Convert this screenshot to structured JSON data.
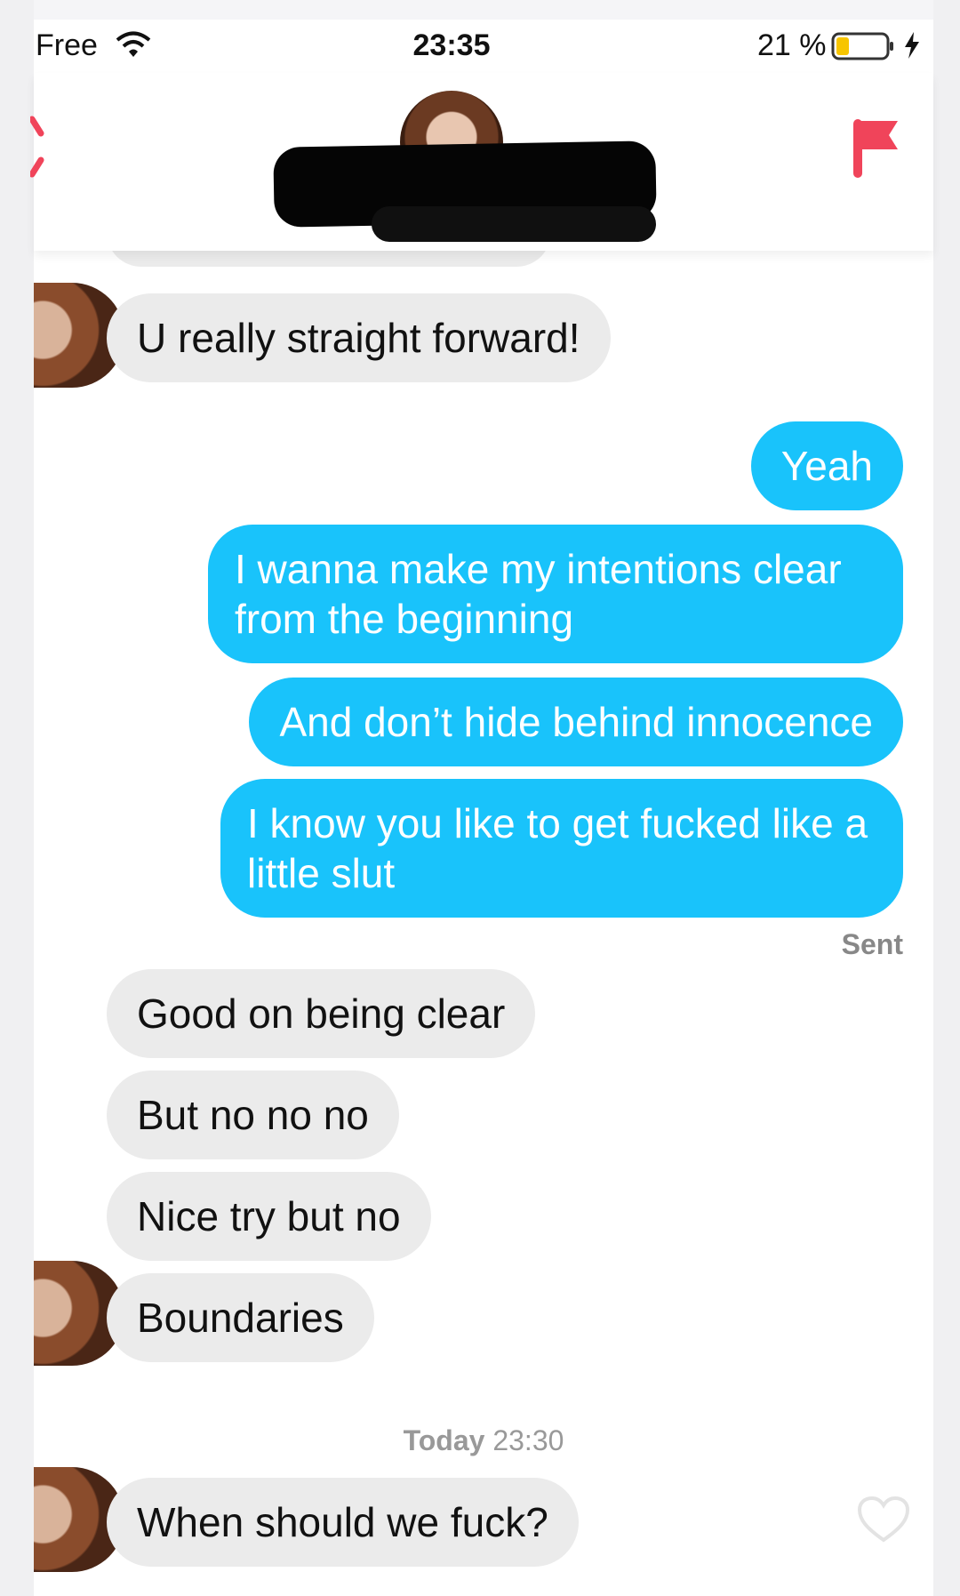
{
  "status_bar": {
    "carrier": "Free",
    "time": "23:35",
    "battery": "21 %"
  },
  "messages": [
    {
      "text": "U really straight forward!"
    },
    {
      "text": "Yeah"
    },
    {
      "text": "I wanna make my intentions clear from the beginning"
    },
    {
      "text": "And don’t hide behind innocence"
    },
    {
      "text": "I know you like to get fucked like a little slut"
    },
    {
      "text": "Good on being clear"
    },
    {
      "text": "But no no no"
    },
    {
      "text": "Nice try but no"
    },
    {
      "text": "Boundaries"
    },
    {
      "text": "When should we fuck?"
    }
  ],
  "sent_label": "Sent",
  "timestamp": {
    "day": "Today",
    "time": "23:30"
  },
  "colors": {
    "incoming": "#ebebeb",
    "outgoing": "#19c3fb",
    "accent": "#f0445a"
  },
  "icons": [
    "wifi-icon",
    "battery-icon",
    "charging-icon",
    "back-icon",
    "flag-icon",
    "heart-icon"
  ]
}
